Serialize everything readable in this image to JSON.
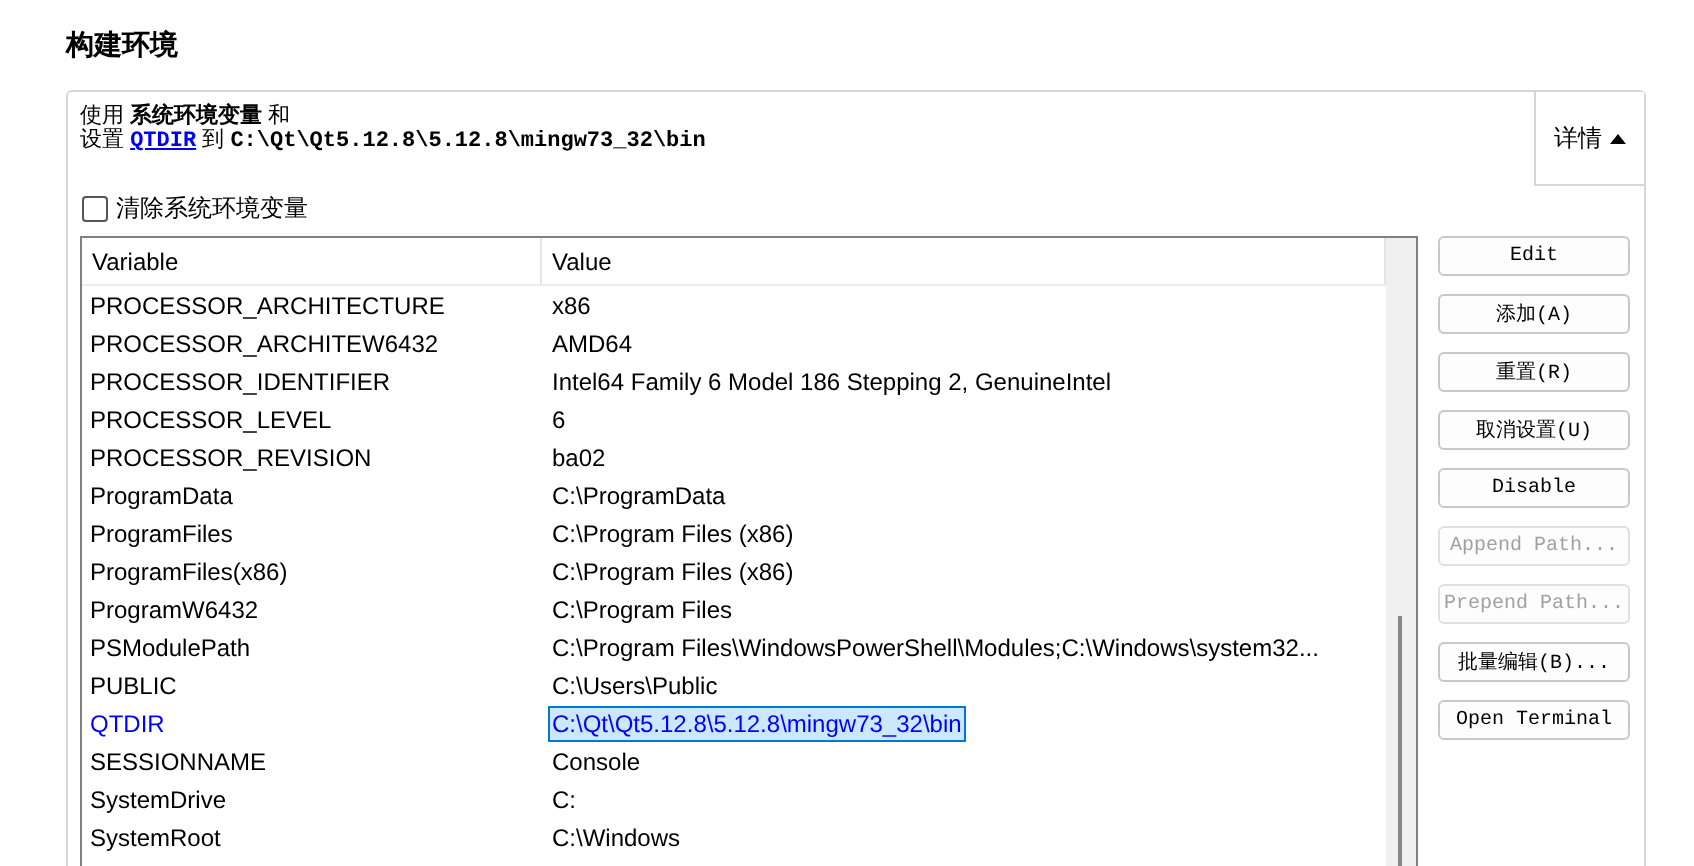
{
  "title": "构建环境",
  "summary": {
    "line_1": "使用 **系统环境变量** 和",
    "line_2": [
      {
        "kind": "text",
        "text": "设置"
      },
      {
        "kind": "link",
        "text": "QTDIR"
      },
      {
        "kind": "text",
        "text": "到"
      },
      {
        "kind": "path",
        "text": "C:\\Qt\\Qt5.12.8\\5.12.8\\mingw73_32\\bin"
      }
    ]
  },
  "details_button": {
    "label": "详情",
    "expanded": true
  },
  "clear_checkbox": {
    "label": "清除系统环境变量",
    "checked": false
  },
  "table": {
    "columns": [
      "Variable",
      "Value"
    ],
    "rows": [
      {
        "name": "PROCESSOR_ARCHITECTURE",
        "value": "x86",
        "changed": false,
        "selected": false
      },
      {
        "name": "PROCESSOR_ARCHITEW6432",
        "value": "AMD64",
        "changed": false,
        "selected": false
      },
      {
        "name": "PROCESSOR_IDENTIFIER",
        "value": "Intel64 Family 6 Model 186 Stepping 2, GenuineIntel",
        "changed": false,
        "selected": false
      },
      {
        "name": "PROCESSOR_LEVEL",
        "value": "6",
        "changed": false,
        "selected": false
      },
      {
        "name": "PROCESSOR_REVISION",
        "value": "ba02",
        "changed": false,
        "selected": false
      },
      {
        "name": "ProgramData",
        "value": "C:\\ProgramData",
        "changed": false,
        "selected": false
      },
      {
        "name": "ProgramFiles",
        "value": "C:\\Program Files (x86)",
        "changed": false,
        "selected": false
      },
      {
        "name": "ProgramFiles(x86)",
        "value": "C:\\Program Files (x86)",
        "changed": false,
        "selected": false
      },
      {
        "name": "ProgramW6432",
        "value": "C:\\Program Files",
        "changed": false,
        "selected": false
      },
      {
        "name": "PSModulePath",
        "value": "C:\\Program Files\\WindowsPowerShell\\Modules;C:\\Windows\\system32...",
        "changed": false,
        "selected": false
      },
      {
        "name": "PUBLIC",
        "value": "C:\\Users\\Public",
        "changed": false,
        "selected": false
      },
      {
        "name": "QTDIR",
        "value": "C:\\Qt\\Qt5.12.8\\5.12.8\\mingw73_32\\bin",
        "changed": true,
        "selected": true
      },
      {
        "name": "SESSIONNAME",
        "value": "Console",
        "changed": false,
        "selected": false
      },
      {
        "name": "SystemDrive",
        "value": "C:",
        "changed": false,
        "selected": false
      },
      {
        "name": "SystemRoot",
        "value": "C:\\Windows",
        "changed": false,
        "selected": false
      }
    ]
  },
  "buttons": [
    {
      "label": "Edit",
      "disabled": false
    },
    {
      "label": "添加(A)",
      "disabled": false
    },
    {
      "label": "重置(R)",
      "disabled": false
    },
    {
      "label": "取消设置(U)",
      "disabled": false
    },
    {
      "label": "Disable",
      "disabled": false
    },
    {
      "label": "Append Path...",
      "disabled": true
    },
    {
      "label": "Prepend Path...",
      "disabled": true
    },
    {
      "label": "批量编辑(B)...",
      "disabled": false
    },
    {
      "label": "Open Terminal",
      "disabled": false
    }
  ]
}
